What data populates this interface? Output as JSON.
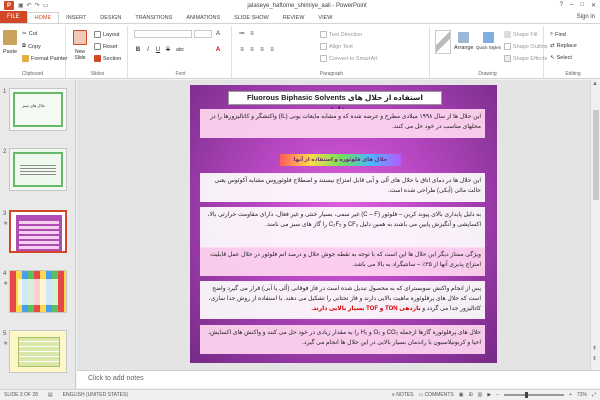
{
  "window": {
    "title": "jalaseye_haftome_shimiye_aali - PowerPoint",
    "app_icon": "P",
    "help": "?",
    "minimize": "–",
    "maximize": "□",
    "close": "✕"
  },
  "ribbon_tabs": {
    "file": "FILE",
    "items": [
      "HOME",
      "INSERT",
      "DESIGN",
      "TRANSITIONS",
      "ANIMATIONS",
      "SLIDE SHOW",
      "REVIEW",
      "VIEW"
    ],
    "active": "HOME",
    "sign_in": "Sign in"
  },
  "clipboard": {
    "paste": "Paste",
    "cut": "Cut",
    "copy": "Copy",
    "format_painter": "Format Painter",
    "label": "Clipboard"
  },
  "slides_group": {
    "new_slide": "New Slide",
    "layout": "Layout",
    "reset": "Reset",
    "section": "Section",
    "label": "Slides"
  },
  "font_group": {
    "bold": "B",
    "italic": "I",
    "underline": "U",
    "strikethrough": "S",
    "shadow": "abc",
    "label": "Font"
  },
  "paragraph_group": {
    "text_direction": "Text Direction",
    "align_text": "Align Text",
    "smartart": "Convert to SmartArt",
    "label": "Paragraph"
  },
  "drawing_group": {
    "arrange": "Arrange",
    "quick_styles": "Quick Styles",
    "shape_fill": "Shape Fill",
    "shape_outline": "Shape Outline",
    "shape_effects": "Shape Effects",
    "label": "Drawing"
  },
  "editing_group": {
    "find": "Find",
    "replace": "Replace",
    "select": "Select",
    "label": "Editing"
  },
  "thumbnails": [
    {
      "number": "1",
      "title": "حلال های سبز"
    },
    {
      "number": "2"
    },
    {
      "number": "3",
      "selected": true
    },
    {
      "number": "4"
    },
    {
      "number": "5"
    }
  ],
  "slide": {
    "title": "Fluorous Biphasic Solvents استفاده از حلال های پرفلوئوره",
    "p1": "این حلال ها از سال ۱۹۹۸ میلادی مطرح و عرضه شده که و مشابه مایعات یونی (IL) واکنشگر و کاتالیزورها را در محلهای مناسب در خود حل می کنند.",
    "banner": "حلال های فلوئوره و استفاده از آنها",
    "p2": "این حلال ها در دمای اتاق با حلال های آلی و آبی قابل امتزاج نیستند و اصطلاح فلوئوروس مشابه آکوئوس یعنی حالت مائی (آبکی) طراحی شده است.",
    "p3": "به دلیل پایداری بالای پیوند کربن – فلوئور (C – F) غیر سمی، بسیار خنثی و غیر فعال، دارای مقاومت حرارتی بالا، اکسایشی و آنگیزش پایین می باشند به همین دلیل CF₃ و C₂F₅ را گاز های سبز می نامند.",
    "p4": "ویژگی ممتاز دیگر این حلال ها این است که با توجه به نقطه جوش حلال و درصد اتم فلوئور در حلال عمل قابلیت امتزاج پذیری آنها از ۳۵٪ – سانتیگراد به بالا می باشد.",
    "p5": "پس از انجام واکنش سوبسترای که به محصول تبدیل شده است در فاز فوقانی (آلی یا آبی) قرار می گیرد واضح است که حلال های پرفلوئوره ماهیت بالایی دارند و فاز تحتانی را تشکیل می دهند. با استفاده از روش جدا سازی، کاتالیزور جدا می گردد و",
    "p5_red": "بازدهی TON و TOF بسیار بالایی دارند.",
    "p6": "حلال های پرفلوئوره گازها ازجمله CO₂ و O₂ و H₂ را به مقدار زیادی در خود حل می کنند و واکنش های اکسایش، احیا و کربونیلاسیون با راندمان بسیار بالایی در این حلال ها انجام می گیرد."
  },
  "notes": {
    "placeholder": "Click to add notes"
  },
  "status": {
    "slide_info": "SLIDE 3 OF 28",
    "language": "ENGLISH (UNITED STATES)",
    "notes_btn": "NOTES",
    "comments_btn": "COMMENTS",
    "zoom_pct": "73%",
    "zoom_level": 0.73
  },
  "colors": {
    "accent": "#d24726",
    "slide_bg": "#b245bd"
  }
}
